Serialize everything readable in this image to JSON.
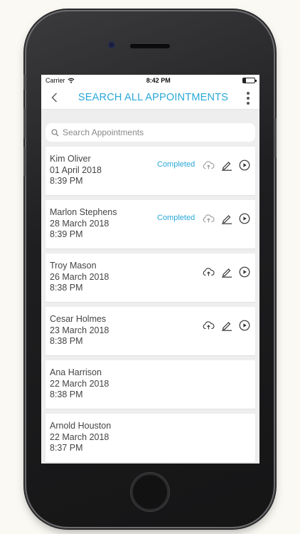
{
  "statusbar": {
    "carrier": "Carrier",
    "time": "8:42 PM"
  },
  "navbar": {
    "title": "SEARCH ALL APPOINTMENTS"
  },
  "search": {
    "placeholder": "Search Appointments"
  },
  "icons": {
    "back": "chevron-left-icon",
    "more": "more-vertical-icon",
    "search": "search-icon",
    "upload": "cloud-upload-icon",
    "edit": "pencil-icon",
    "play": "play-circle-icon"
  },
  "colors": {
    "accent": "#29a8d8",
    "background": "#eeeeee",
    "card": "#ffffff"
  },
  "appointments": [
    {
      "name": "Kim Oliver",
      "date": "01 April 2018",
      "time": "8:39 PM",
      "status": "Completed",
      "actions": true
    },
    {
      "name": "Marlon Stephens",
      "date": "28 March 2018",
      "time": "8:39 PM",
      "status": "Completed",
      "actions": true
    },
    {
      "name": "Troy Mason",
      "date": "26 March 2018",
      "time": "8:38 PM",
      "status": "",
      "actions": true
    },
    {
      "name": "Cesar Holmes",
      "date": "23 March 2018",
      "time": "8:38 PM",
      "status": "",
      "actions": true
    },
    {
      "name": "Ana Harrison",
      "date": "22 March 2018",
      "time": "8:38 PM",
      "status": "",
      "actions": false
    },
    {
      "name": "Arnold Houston",
      "date": "22 March 2018",
      "time": "8:37 PM",
      "status": "",
      "actions": false
    }
  ]
}
